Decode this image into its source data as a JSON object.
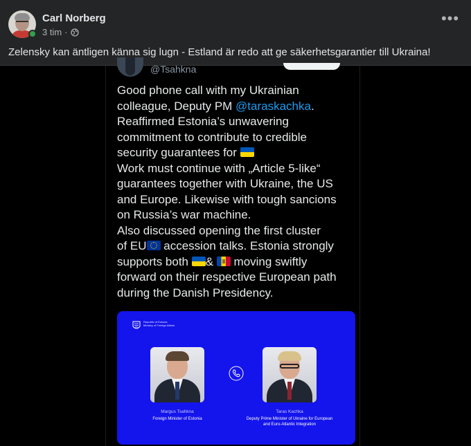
{
  "post": {
    "author": "Carl Norberg",
    "time": "3 tim",
    "separator": "·",
    "privacy_icon": "globe-icon",
    "more_icon": "more-horizontal-icon",
    "more_label": "•••",
    "text": "Zelensky kan äntligen känna sig lugn - Estland är redo att ge säkerhetsgarantier till Ukraina!"
  },
  "tweet": {
    "handle": "@Tsahkna",
    "lines": [
      {
        "pre": "Good phone call with my Ukrainian"
      },
      {
        "pre": "colleague, Deputy PM ",
        "mention": "@taraskachka",
        "post": "."
      },
      {
        "pre": "Reaffirmed Estonia’s unwavering"
      },
      {
        "pre": "commitment to contribute to credible"
      },
      {
        "pre": "security guarantees for ",
        "flag1": "ua"
      },
      {
        "pre": "Work must continue with „Article 5-like“"
      },
      {
        "pre": "guarantees together with Ukraine, the US"
      },
      {
        "pre": "and Europe. Likewise with tough sancions"
      },
      {
        "pre": "on Russia’s war machine."
      },
      {
        "pre": "Also discussed opening the first cluster"
      },
      {
        "pre": "of EU",
        "flag1": "eu",
        "post": " accession talks. Estonia strongly"
      },
      {
        "pre": "supports both ",
        "flag1": "ua",
        "mid": "& ",
        "flag2": "md",
        "post": "  moving swiftly"
      },
      {
        "pre": "forward on their respective European path"
      },
      {
        "pre": "during the Danish Presidency."
      }
    ]
  },
  "card": {
    "ministry": [
      "Republic of Estonia",
      "Ministry of Foreign Affairs"
    ],
    "left_person": {
      "name": "Margus Tsahkna",
      "role": "Foreign Minister of Estonia"
    },
    "right_person": {
      "name": "Taras Kachka",
      "role": "Deputy Prime Minister of Ukraine for European and Euro-Atlantic Integration"
    },
    "background_color": "#1414ec"
  },
  "colors": {
    "link": "#1d9bf0",
    "online": "#31a24c"
  }
}
